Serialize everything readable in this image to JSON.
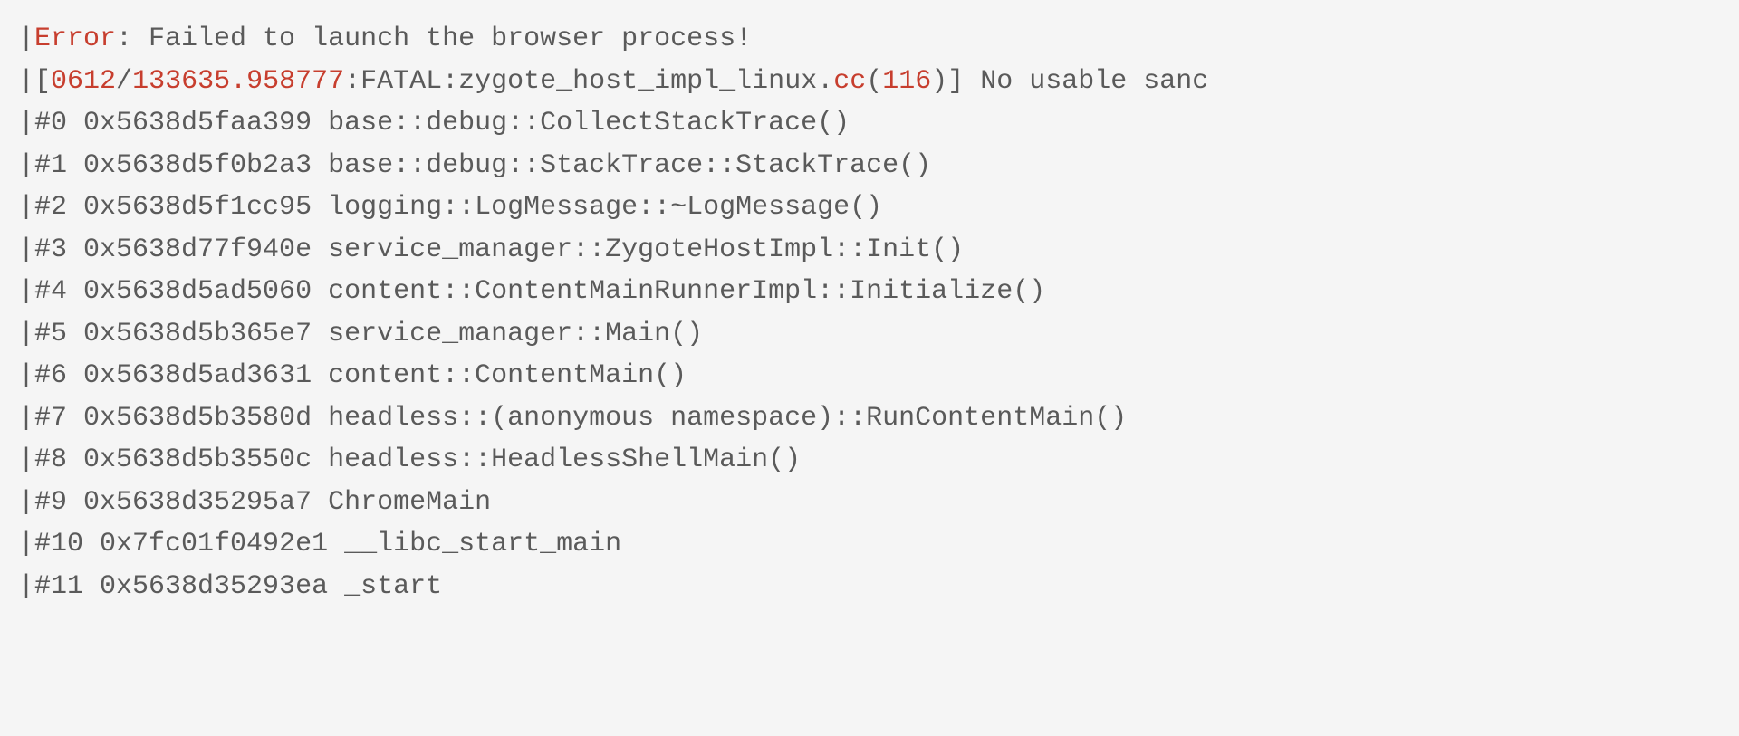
{
  "prefix": "| ",
  "error_label": "Error",
  "error_msg": ": Failed to launch the browser process!",
  "logline": {
    "prefix": "[",
    "ts1": "0612",
    "slash": "/",
    "ts2": "133635.958777",
    "mid": ":FATAL:zygote_host_impl_linux.",
    "cc": "cc",
    "lparen": "(",
    "lineno": "116",
    "rparen_suffix": ")] No usable sanc"
  },
  "stack": [
    "#0 0x5638d5faa399 base::debug::CollectStackTrace()",
    "#1 0x5638d5f0b2a3 base::debug::StackTrace::StackTrace()",
    "#2 0x5638d5f1cc95 logging::LogMessage::~LogMessage()",
    "#3 0x5638d77f940e service_manager::ZygoteHostImpl::Init()",
    "#4 0x5638d5ad5060 content::ContentMainRunnerImpl::Initialize()",
    "#5 0x5638d5b365e7 service_manager::Main()",
    "#6 0x5638d5ad3631 content::ContentMain()",
    "#7 0x5638d5b3580d headless::(anonymous namespace)::RunContentMain()",
    "#8 0x5638d5b3550c headless::HeadlessShellMain()",
    "#9 0x5638d35295a7 ChromeMain",
    "#10 0x7fc01f0492e1 __libc_start_main",
    "#11 0x5638d35293ea _start"
  ]
}
